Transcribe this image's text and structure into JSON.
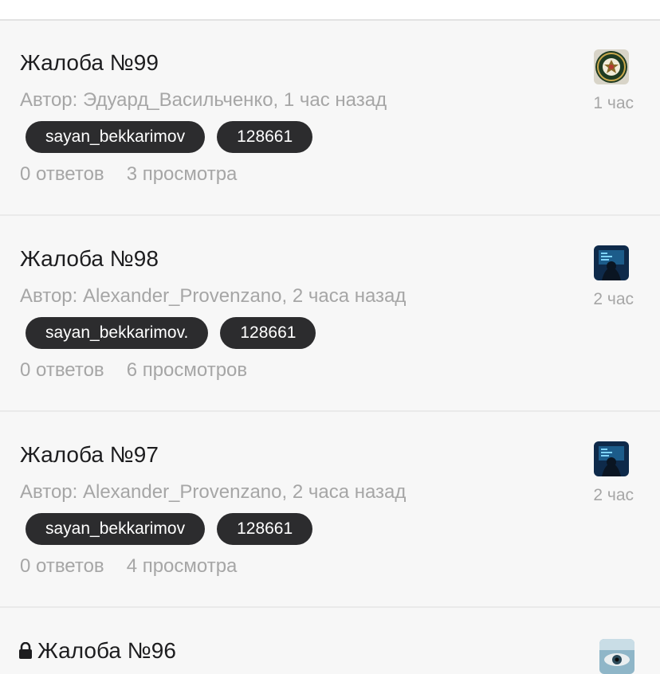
{
  "threads": [
    {
      "title": "Жалоба №99",
      "author": "Автор: Эдуард_Васильченко, 1 час назад",
      "tags": [
        "sayan_bekkarimov",
        "128661"
      ],
      "answers": "0 ответов",
      "views": "3 просмотра",
      "time": "1 час",
      "avatar": "army-seal-avatar",
      "locked": false
    },
    {
      "title": "Жалоба №98",
      "author": "Автор: Alexander_Provenzano, 2 часа назад",
      "tags": [
        "sayan_bekkarimov.",
        "128661"
      ],
      "answers": "0 ответов",
      "views": "6 просмотров",
      "time": "2 час",
      "avatar": "hacker-avatar",
      "locked": false
    },
    {
      "title": "Жалоба №97",
      "author": "Автор: Alexander_Provenzano, 2 часа назад",
      "tags": [
        "sayan_bekkarimov",
        "128661"
      ],
      "answers": "0 ответов",
      "views": "4 просмотра",
      "time": "2 час",
      "avatar": "hacker-avatar",
      "locked": false
    },
    {
      "title": "Жалоба №96",
      "avatar": "eye-avatar",
      "locked": true
    }
  ],
  "colors": {
    "background": "#f7f7f7",
    "title": "#1d1d1f",
    "meta": "#a6a6a6",
    "tag_bg": "#2c2c2e",
    "tag_text": "#ffffff"
  }
}
